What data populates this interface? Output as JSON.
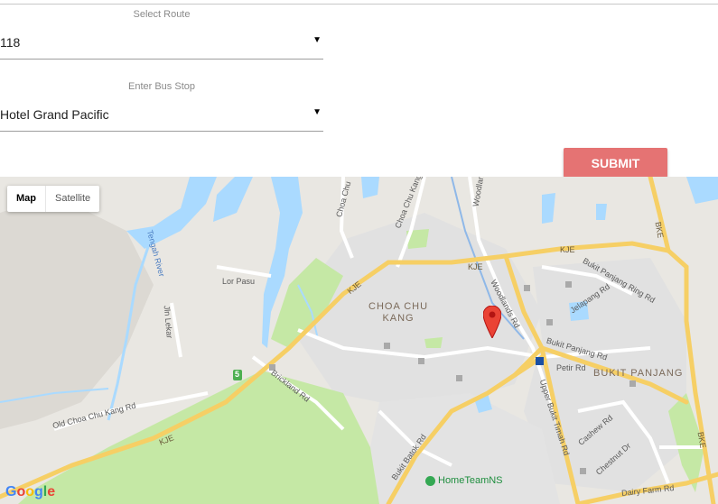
{
  "form": {
    "route": {
      "label": "Select Route",
      "value": "118",
      "caret": "▼"
    },
    "stop": {
      "label": "Enter Bus Stop",
      "value": "Hotel Grand Pacific",
      "caret": "▼"
    },
    "submit_label": "SUBMIT"
  },
  "map": {
    "type_buttons": {
      "map": "Map",
      "satellite": "Satellite"
    },
    "areas": {
      "choa": "CHOA CHU\nKANG",
      "bukit_panjang": "BUKIT PANJANG"
    },
    "highways": {
      "kje1": "KJE",
      "kje2": "KJE",
      "kje3": "KJE",
      "kje4": "KJE",
      "bke1": "BKE",
      "bke2": "BKE"
    },
    "roads": {
      "choa_chu": "Choa Chu",
      "choa_chu_kang": "Choa Chu Kang",
      "woodlands": "Woodlands",
      "woodlands_rd": "Woodlands Rd",
      "lor_pasu": "Lor Pasu",
      "jln_lekar": "Jln Lekar",
      "brickland": "Brickland Rd",
      "old_cck": "Old Choa Chu Kang Rd",
      "bukit_batok": "Bukit Batok Rd",
      "upper_bt": "Upper Bukit Timah Rd",
      "bukit_panjang_rd": "Bukit Panjang Rd",
      "bp_ring": "Bukit Panjang Ring Rd",
      "jelapang": "Jelapang Rd",
      "petir": "Petir Rd",
      "cashew": "Cashew Rd",
      "chestnut": "Chestnut Dr",
      "dairy_farm": "Dairy Farm Rd"
    },
    "water": {
      "tengah": "Tengah River"
    },
    "poi": "HomeTeamNS",
    "expressway_shield": "5",
    "logo": "Google"
  },
  "colors": {
    "submit_bg": "#e57373",
    "map_bg": "#e9e7e2",
    "water": "#aadaff",
    "park": "#c5e8a5",
    "highway": "#f6cf65",
    "pin": "#ea4335"
  }
}
